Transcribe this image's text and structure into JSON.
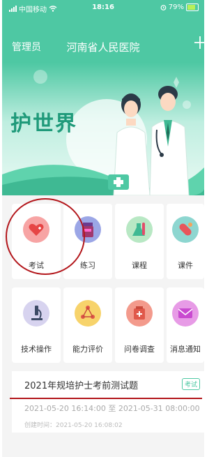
{
  "status_bar": {
    "carrier": "中国移动",
    "time": "18:16",
    "battery": "79%"
  },
  "nav": {
    "left": "管理员",
    "title": "河南省人民医院",
    "right_icon": "plus-icon"
  },
  "banner": {
    "title": "护世界"
  },
  "menu": [
    {
      "label": "考试",
      "icon": "heart-plus-icon",
      "color": "#f08080"
    },
    {
      "label": "练习",
      "icon": "jar-icon",
      "color": "#9ba6e6"
    },
    {
      "label": "课程",
      "icon": "flask-icon",
      "color": "#b8e8c4"
    },
    {
      "label": "课件",
      "icon": "capsule-icon",
      "color": "#8dd6d0"
    },
    {
      "label": "技术操作",
      "icon": "microscope-icon",
      "color": "#d7d3ef"
    },
    {
      "label": "能力评价",
      "icon": "molecule-icon",
      "color": "#f7d36b"
    },
    {
      "label": "问卷调查",
      "icon": "kit-icon",
      "color": "#f39a8c"
    },
    {
      "label": "消息通知",
      "icon": "mail-icon",
      "color": "#e79be6"
    }
  ],
  "exam_card": {
    "title": "2021年规培护士考前测试题",
    "badge": "考试",
    "date_range": "2021-05-20 16:14:00 至 2021-05-31 08:00:00",
    "created": "创建时间：2021-05-20 16:08:02"
  },
  "colors": {
    "brand": "#4ec8a3",
    "annotation": "#b3161b"
  }
}
